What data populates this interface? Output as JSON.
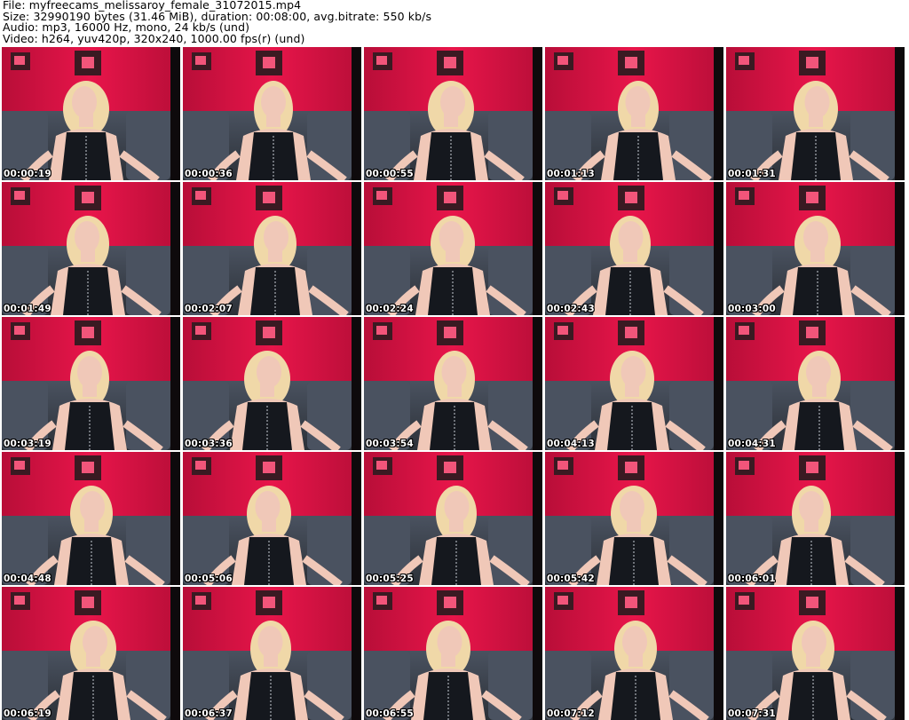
{
  "header": {
    "file_line": "File: myfreecams_melissaroy_female_31072015.mp4",
    "size_line": "Size: 32990190 bytes (31.46 MiB), duration: 00:08:00, avg.bitrate: 550 kb/s",
    "audio_line": "Audio: mp3, 16000 Hz, mono, 24 kb/s (und)",
    "video_line": "Video: h264, yuv420p, 320x240, 1000.00 fps(r) (und)"
  },
  "colors": {
    "wall": "#e8154a",
    "wall_dark": "#b80e38",
    "sofa": "#2c3138",
    "sofa_highlight": "#4a5260",
    "frame": "#3a1a22",
    "frame_inner": "#f2557a",
    "hair": "#f0d8a8",
    "skin": "#f0c8b8",
    "dress": "#15181e",
    "right_edge": "#0e0a0c"
  },
  "thumbnails": [
    {
      "timestamp": "00:00:19"
    },
    {
      "timestamp": "00:00:36"
    },
    {
      "timestamp": "00:00:55"
    },
    {
      "timestamp": "00:01:13"
    },
    {
      "timestamp": "00:01:31"
    },
    {
      "timestamp": "00:01:49"
    },
    {
      "timestamp": "00:02:07"
    },
    {
      "timestamp": "00:02:24"
    },
    {
      "timestamp": "00:02:43"
    },
    {
      "timestamp": "00:03:00"
    },
    {
      "timestamp": "00:03:19"
    },
    {
      "timestamp": "00:03:36"
    },
    {
      "timestamp": "00:03:54"
    },
    {
      "timestamp": "00:04:13"
    },
    {
      "timestamp": "00:04:31"
    },
    {
      "timestamp": "00:04:48"
    },
    {
      "timestamp": "00:05:06"
    },
    {
      "timestamp": "00:05:25"
    },
    {
      "timestamp": "00:05:42"
    },
    {
      "timestamp": "00:06:01"
    },
    {
      "timestamp": "00:06:19"
    },
    {
      "timestamp": "00:06:37"
    },
    {
      "timestamp": "00:06:55"
    },
    {
      "timestamp": "00:07:12"
    },
    {
      "timestamp": "00:07:31"
    }
  ]
}
